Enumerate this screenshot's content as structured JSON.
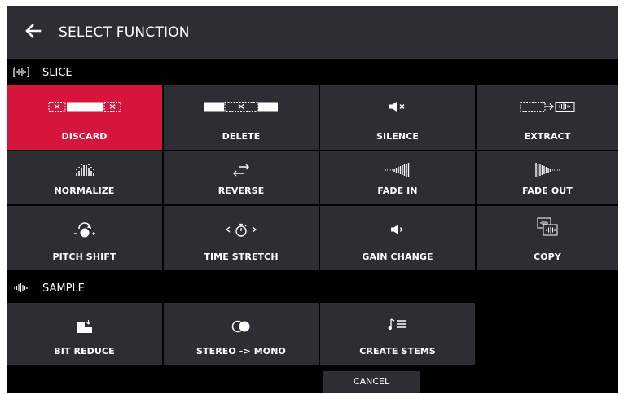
{
  "header": {
    "title": "SELECT FUNCTION",
    "back_icon": "arrow-left-icon"
  },
  "sections": [
    {
      "label": "SLICE",
      "icon": "slice-waveform-icon"
    },
    {
      "label": "SAMPLE",
      "icon": "sample-waveform-icon"
    }
  ],
  "slice_functions": [
    {
      "label": "DISCARD",
      "icon": "discard-icon",
      "selected": true
    },
    {
      "label": "DELETE",
      "icon": "delete-icon"
    },
    {
      "label": "SILENCE",
      "icon": "speaker-mute-icon"
    },
    {
      "label": "EXTRACT",
      "icon": "extract-icon"
    },
    {
      "label": "NORMALIZE",
      "icon": "normalize-icon"
    },
    {
      "label": "REVERSE",
      "icon": "reverse-arrows-icon"
    },
    {
      "label": "FADE IN",
      "icon": "fade-in-icon"
    },
    {
      "label": "FADE OUT",
      "icon": "fade-out-icon"
    },
    {
      "label": "PITCH SHIFT",
      "icon": "pitch-dial-icon"
    },
    {
      "label": "TIME STRETCH",
      "icon": "stopwatch-arrows-icon"
    },
    {
      "label": "GAIN CHANGE",
      "icon": "speaker-volume-icon"
    },
    {
      "label": "COPY",
      "icon": "copy-waveform-icon"
    }
  ],
  "sample_functions": [
    {
      "label": "BIT REDUCE",
      "icon": "bit-reduce-icon"
    },
    {
      "label": "STEREO -> MONO",
      "icon": "stereo-mono-icon"
    },
    {
      "label": "CREATE STEMS",
      "icon": "stems-icon"
    }
  ],
  "footer": {
    "cancel_label": "CANCEL"
  },
  "colors": {
    "accent": "#d6153c",
    "tile": "#2d2d33",
    "background": "#000000",
    "text": "#ffffff"
  }
}
